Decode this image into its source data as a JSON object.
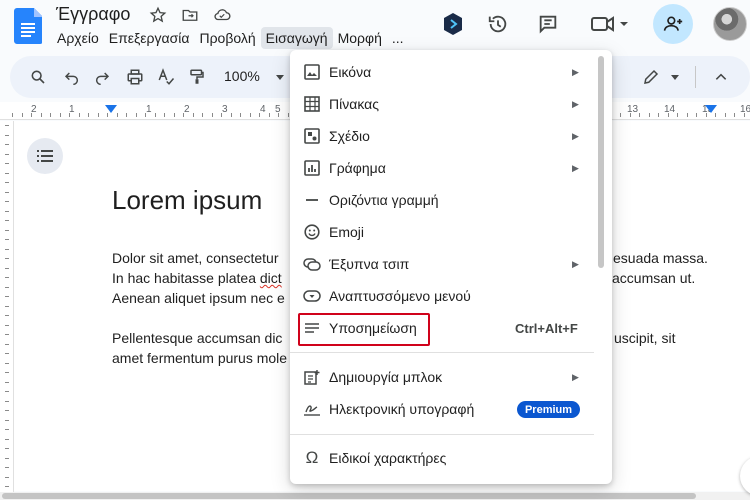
{
  "header": {
    "doc_title": "Έγγραφο",
    "menus": [
      "Αρχείο",
      "Επεξεργασία",
      "Προβολή",
      "Εισαγωγή",
      "Μορφή",
      "..."
    ],
    "active_menu": "Εισαγωγή"
  },
  "toolbar": {
    "zoom": "100%"
  },
  "ruler": {
    "numbers": [
      "2",
      "1",
      "1",
      "2",
      "3",
      "4",
      "5",
      "13",
      "14",
      "15",
      "16"
    ]
  },
  "document": {
    "heading": "Lorem ipsum",
    "paragraph1": [
      "Dolor sit amet, consectetur",
      "esuada massa.",
      "In hac habitasse platea ",
      "dict",
      "accumsan ut.",
      "Aenean aliquet ipsum nec e"
    ],
    "paragraph2": [
      "Pellentesque accumsan dic",
      "uscipit, sit",
      "amet fermentum purus mole"
    ]
  },
  "insert_menu": {
    "items": [
      {
        "label": "Εικόνα",
        "icon": "image-icon",
        "submenu": true
      },
      {
        "label": "Πίνακας",
        "icon": "table-icon",
        "submenu": true
      },
      {
        "label": "Σχέδιο",
        "icon": "drawing-icon",
        "submenu": true
      },
      {
        "label": "Γράφημα",
        "icon": "chart-icon",
        "submenu": true
      },
      {
        "label": "Οριζόντια γραμμή",
        "icon": "horizontal-line-icon",
        "submenu": false
      },
      {
        "label": "Emoji",
        "icon": "emoji-icon",
        "submenu": false
      },
      {
        "label": "Έξυπνα τσιπ",
        "icon": "smart-chips-icon",
        "submenu": true
      },
      {
        "label": "Αναπτυσσόμενο μενού",
        "icon": "dropdown-icon",
        "submenu": false
      },
      {
        "label": "Υποσημείωση",
        "icon": "footnote-icon",
        "shortcut": "Ctrl+Alt+F",
        "highlighted": true
      },
      {
        "label": "Δημιουργία μπλοκ",
        "icon": "building-blocks-icon",
        "submenu": true
      },
      {
        "label": "Ηλεκτρονική υπογραφή",
        "icon": "esignature-icon",
        "badge": "Premium"
      },
      {
        "label": "Ειδικοί χαρακτήρες",
        "icon": "omega-icon",
        "submenu": false
      }
    ]
  },
  "colors": {
    "accent": "#0b57d0",
    "highlight_border": "#d0021b",
    "share_button": "#c2e7ff"
  }
}
